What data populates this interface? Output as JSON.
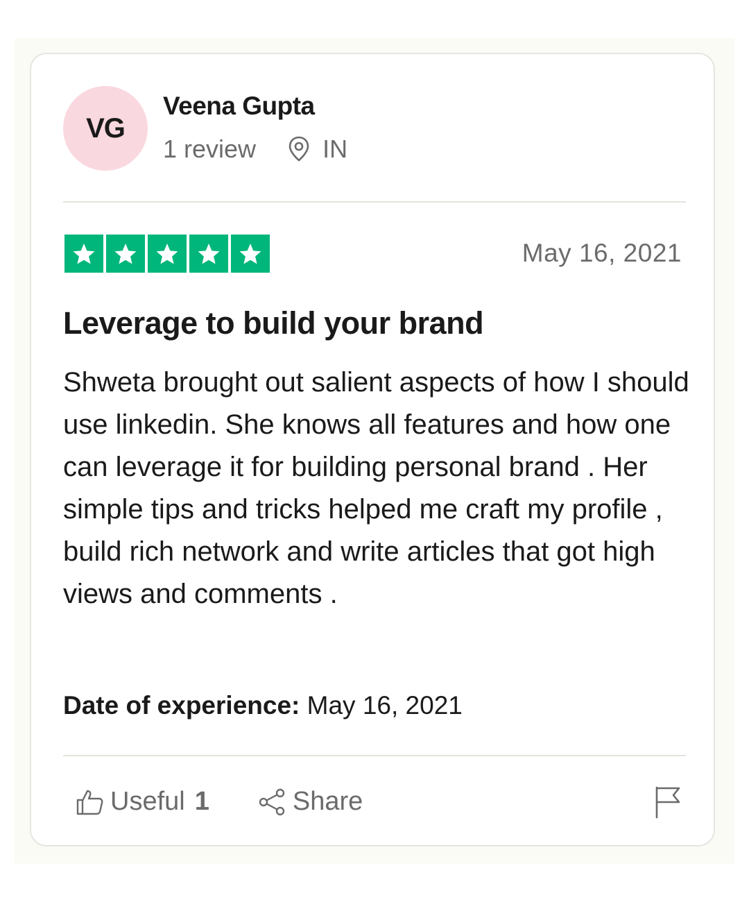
{
  "reviewer": {
    "initials": "VG",
    "name": "Veena Gupta",
    "review_count": "1 review",
    "location": "IN",
    "avatar_color": "#fad8df"
  },
  "rating": {
    "stars": 5,
    "max": 5,
    "color": "#00b67a"
  },
  "review": {
    "date": "May 16, 2021",
    "title": "Leverage to build your brand",
    "body": "Shweta brought out salient aspects of how I should use linkedin. She knows all features and how one can leverage it for building personal brand . Her simple tips and tricks helped me craft my profile , build rich network and write articles that got high views and comments .",
    "experience_label": "Date of experience:",
    "experience_date": "May 16, 2021"
  },
  "actions": {
    "useful_label": "Useful",
    "useful_count": "1",
    "share_label": "Share"
  },
  "icons": {
    "location": "location-pin-icon",
    "useful": "thumbs-up-icon",
    "share": "share-icon",
    "report": "flag-icon",
    "star": "star-icon"
  }
}
